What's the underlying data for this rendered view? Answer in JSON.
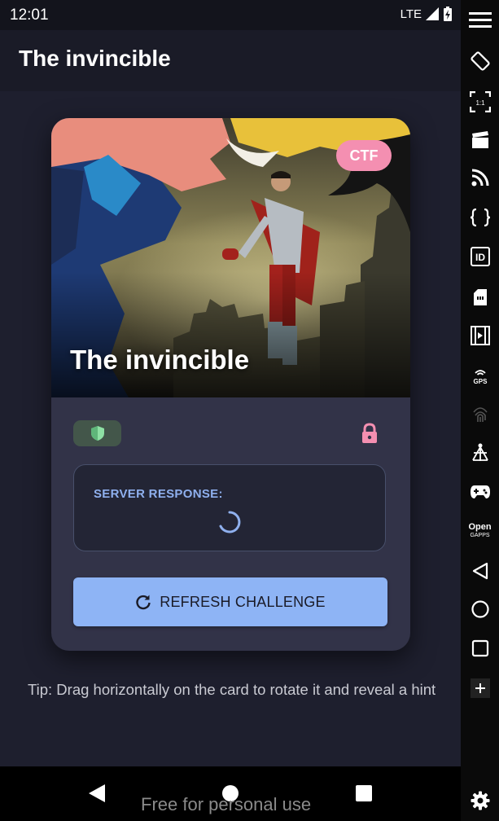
{
  "status_bar": {
    "time": "12:01",
    "network": "LTE"
  },
  "app_bar": {
    "title": "The invincible"
  },
  "card": {
    "hero_title": "The invincible",
    "badge": "CTF",
    "server_response_label": "SERVER RESPONSE:",
    "refresh_button_label": "REFRESH CHALLENGE"
  },
  "tip": "Tip: Drag horizontally on the card to rotate it and reveal a hint",
  "watermark": "Free for personal use",
  "sidebar": {
    "open_gapps_line1": "Open",
    "open_gapps_line2": "GAPPS",
    "gps_label": "GPS",
    "id_label": "ID",
    "scale_label": "1:1"
  },
  "colors": {
    "background": "#1e1f2e",
    "card": "#323348",
    "accent": "#8eb4f5",
    "badge": "#f48fb1",
    "lock": "#f48fb1"
  },
  "icons": [
    "menu-icon",
    "rotate-icon",
    "scale-icon",
    "clapper-icon",
    "rss-icon",
    "braces-icon",
    "id-icon",
    "sd-card-icon",
    "film-icon",
    "gps-icon",
    "fingerprint-icon",
    "network-icon",
    "gamepad-icon",
    "open-gapps-icon",
    "back-icon",
    "home-icon",
    "recents-icon",
    "plus-icon",
    "settings-icon"
  ]
}
